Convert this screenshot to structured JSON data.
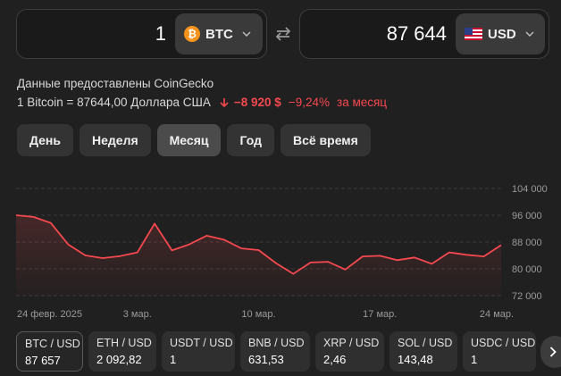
{
  "converter": {
    "from_amount": "1",
    "from_currency": "BTC",
    "from_icon": "bitcoin-icon",
    "to_amount": "87 644",
    "to_currency": "USD",
    "to_icon": "us-flag-icon"
  },
  "info": {
    "source": "Данные предоставлены CoinGecko",
    "rate_text": "1 Bitcoin = 87644,00 Доллара США",
    "change_abs": "−8 920 $",
    "change_pct": "−9,24%",
    "change_period": "за месяц",
    "change_color": "#f5484f"
  },
  "periods": [
    {
      "label": "День",
      "active": false
    },
    {
      "label": "Неделя",
      "active": false
    },
    {
      "label": "Месяц",
      "active": true
    },
    {
      "label": "Год",
      "active": false
    },
    {
      "label": "Всё время",
      "active": false
    }
  ],
  "chart_data": {
    "type": "area",
    "title": "",
    "xlabel": "",
    "ylabel": "",
    "ylim": [
      72000,
      104000
    ],
    "y_ticks": [
      "104 000",
      "96 000",
      "88 000",
      "80 000",
      "72 000"
    ],
    "y_tick_values": [
      104000,
      96000,
      88000,
      80000,
      72000
    ],
    "x_ticks": [
      {
        "label": "24 февр. 2025",
        "x": 0
      },
      {
        "label": "3 мар.",
        "x": 7
      },
      {
        "label": "10 мар.",
        "x": 14
      },
      {
        "label": "17 мар.",
        "x": 21
      },
      {
        "label": "24 мар.",
        "x": 28
      }
    ],
    "x": [
      0,
      1,
      2,
      3,
      4,
      5,
      6,
      7,
      8,
      9,
      10,
      11,
      12,
      13,
      14,
      15,
      16,
      17,
      18,
      19,
      20,
      21,
      22,
      23,
      24,
      25,
      26,
      27,
      28
    ],
    "series": [
      {
        "values": [
          96000,
          95500,
          93700,
          87300,
          84000,
          83200,
          83800,
          84900,
          93500,
          85500,
          87300,
          89900,
          88700,
          86100,
          85600,
          81700,
          78500,
          81900,
          82100,
          79800,
          83700,
          83900,
          82600,
          83400,
          81500,
          84900,
          84200,
          83700,
          87100
        ]
      }
    ],
    "line_color": "#f5484f",
    "grid": true,
    "legend": "none"
  },
  "pairs": [
    {
      "name": "BTC / USD",
      "value": "87 657",
      "active": true
    },
    {
      "name": "ETH / USD",
      "value": "2 092,82",
      "active": false
    },
    {
      "name": "USDT / USD",
      "value": "1",
      "active": false
    },
    {
      "name": "BNB / USD",
      "value": "631,53",
      "active": false
    },
    {
      "name": "XRP / USD",
      "value": "2,46",
      "active": false
    },
    {
      "name": "SOL / USD",
      "value": "143,48",
      "active": false
    },
    {
      "name": "USDC / USD",
      "value": "1",
      "active": false
    }
  ],
  "icons": {
    "swap": "swap-arrows-icon",
    "chevron": "chevron-down-icon",
    "down": "arrow-down-icon",
    "next": "chevron-right-icon"
  }
}
